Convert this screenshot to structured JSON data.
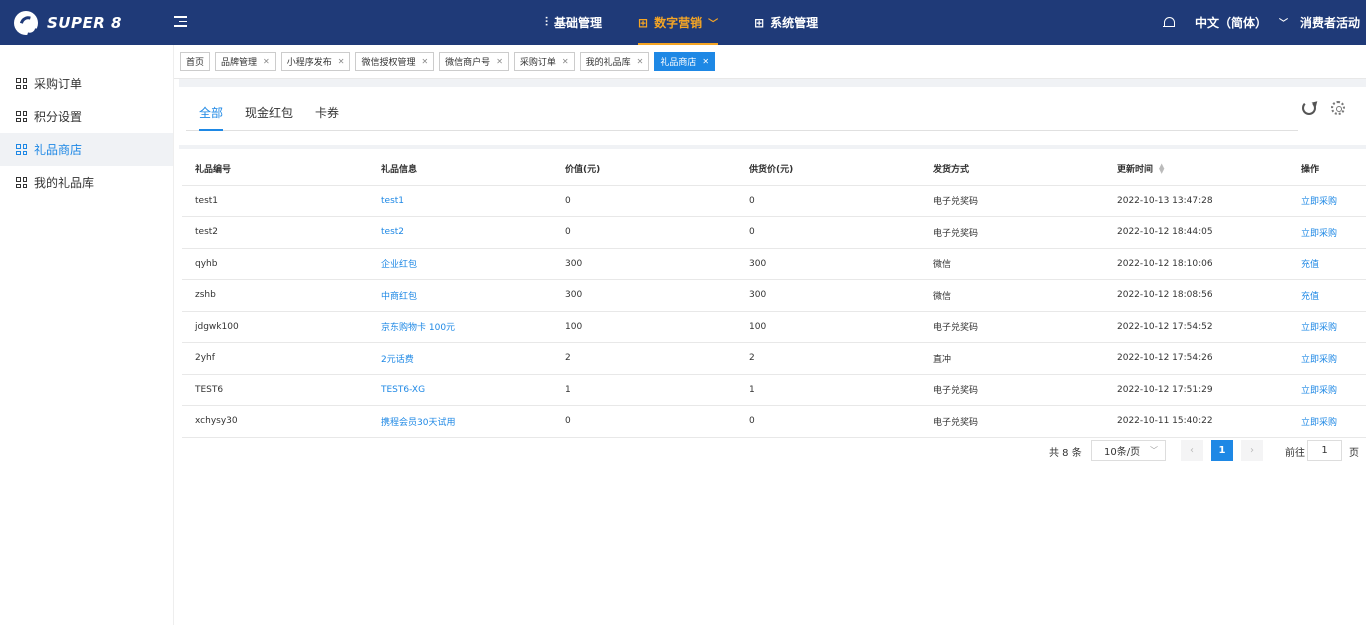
{
  "header": {
    "brand": "SUPER 8",
    "nav": [
      {
        "label": "基础管理",
        "icon": "sliders-icon"
      },
      {
        "label": "数字营销",
        "icon": "grid-icon",
        "active": true
      },
      {
        "label": "系统管理",
        "icon": "grid-icon"
      }
    ],
    "language": "中文（简体）",
    "user": "消费者活动"
  },
  "sidebar": {
    "items": [
      {
        "label": "采购订单"
      },
      {
        "label": "积分设置"
      },
      {
        "label": "礼品商店",
        "active": true
      },
      {
        "label": "我的礼品库"
      }
    ]
  },
  "tagbar": {
    "tags": [
      {
        "label": "首页",
        "closable": false
      },
      {
        "label": "品牌管理",
        "closable": true
      },
      {
        "label": "小程序发布",
        "closable": true
      },
      {
        "label": "微信授权管理",
        "closable": true
      },
      {
        "label": "微信商户号",
        "closable": true
      },
      {
        "label": "采购订单",
        "closable": true
      },
      {
        "label": "我的礼品库",
        "closable": true
      },
      {
        "label": "礼品商店",
        "closable": true,
        "active": true
      }
    ]
  },
  "tabs": [
    {
      "label": "全部",
      "active": true
    },
    {
      "label": "现金红包"
    },
    {
      "label": "卡券"
    }
  ],
  "table": {
    "columns": [
      "礼品编号",
      "礼品信息",
      "价值(元)",
      "供货价(元)",
      "发货方式",
      "更新时间",
      "操作"
    ],
    "rows": [
      {
        "id": "test1",
        "info": "test1",
        "value": "0",
        "supply": "0",
        "delivery": "电子兑奖码",
        "updated": "2022-10-13 13:47:28",
        "action": "立即采购"
      },
      {
        "id": "test2",
        "info": "test2",
        "value": "0",
        "supply": "0",
        "delivery": "电子兑奖码",
        "updated": "2022-10-12 18:44:05",
        "action": "立即采购"
      },
      {
        "id": "qyhb",
        "info": "企业红包",
        "value": "300",
        "supply": "300",
        "delivery": "微信",
        "updated": "2022-10-12 18:10:06",
        "action": "充值"
      },
      {
        "id": "zshb",
        "info": "中商红包",
        "value": "300",
        "supply": "300",
        "delivery": "微信",
        "updated": "2022-10-12 18:08:56",
        "action": "充值"
      },
      {
        "id": "jdgwk100",
        "info": "京东购物卡 100元",
        "value": "100",
        "supply": "100",
        "delivery": "电子兑奖码",
        "updated": "2022-10-12 17:54:52",
        "action": "立即采购"
      },
      {
        "id": "2yhf",
        "info": "2元话费",
        "value": "2",
        "supply": "2",
        "delivery": "直冲",
        "updated": "2022-10-12 17:54:26",
        "action": "立即采购"
      },
      {
        "id": "TEST6",
        "info": "TEST6-XG",
        "value": "1",
        "supply": "1",
        "delivery": "电子兑奖码",
        "updated": "2022-10-12 17:51:29",
        "action": "立即采购"
      },
      {
        "id": "xchysy30",
        "info": "携程会员30天试用",
        "value": "0",
        "supply": "0",
        "delivery": "电子兑奖码",
        "updated": "2022-10-11 15:40:22",
        "action": "立即采购"
      }
    ]
  },
  "pagination": {
    "total": "共 8 条",
    "page_size": "10条/页",
    "current_page": "1",
    "goto_label": "前往",
    "goto_value": "1",
    "goto_suffix": "页"
  },
  "colors": {
    "header_bg": "#1f3a78",
    "accent": "#1e88e5",
    "nav_active": "#f5a524"
  }
}
